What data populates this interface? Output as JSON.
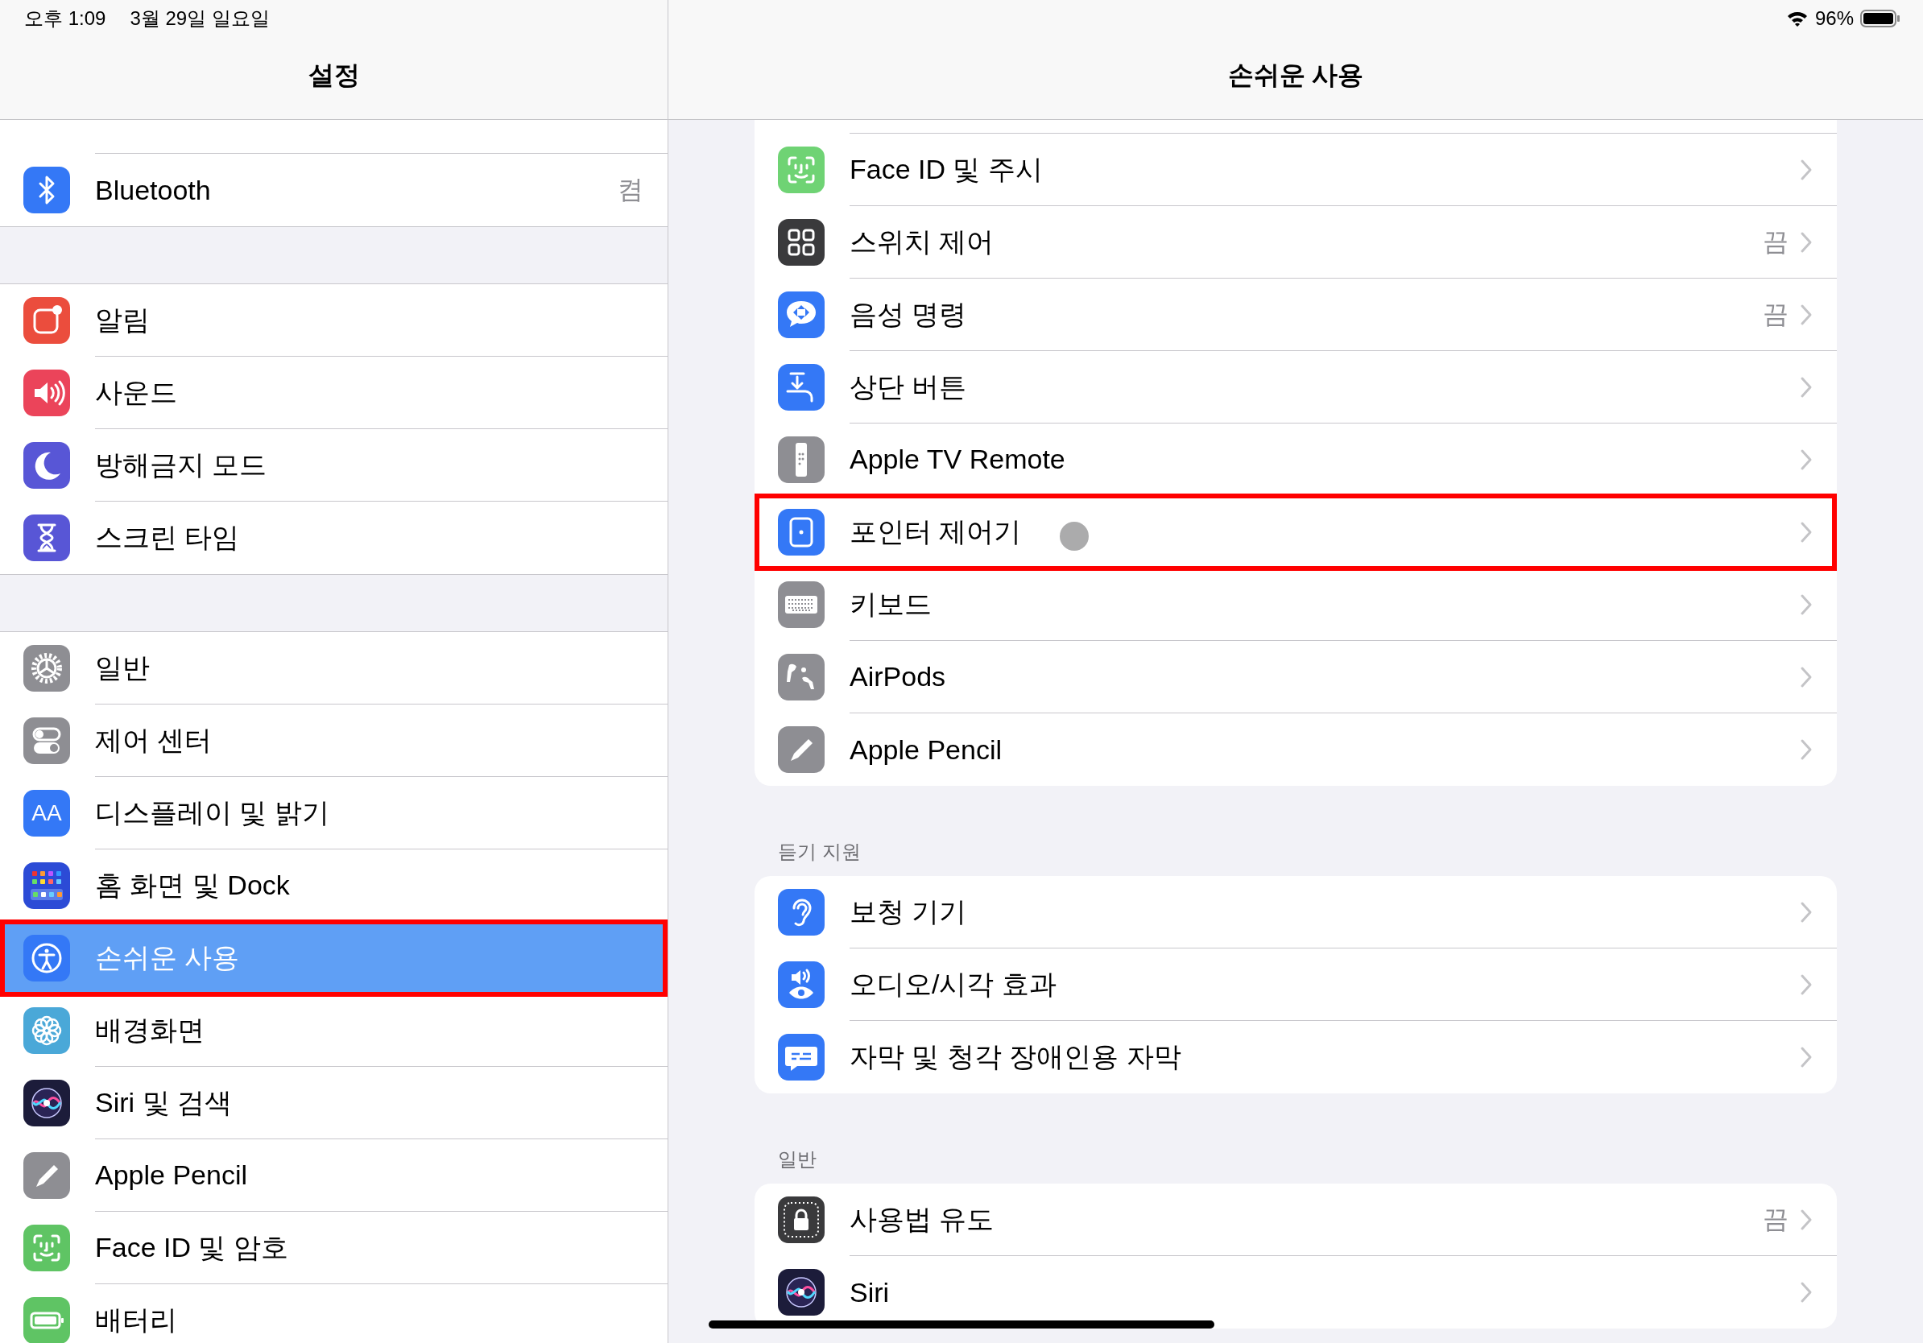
{
  "status_bar": {
    "time": "오후 1:09",
    "date": "3월 29일 일요일",
    "battery": "96%"
  },
  "sidebar": {
    "title": "설정",
    "sections": [
      [
        {
          "label": "Bluetooth",
          "value": "켬",
          "kind": "bluetooth",
          "color": "#3478f6",
          "selected": false,
          "annotated": false
        }
      ],
      [
        {
          "label": "알림",
          "kind": "notifications",
          "color": "#eb4d3d",
          "selected": false,
          "annotated": false
        },
        {
          "label": "사운드",
          "kind": "sound",
          "color": "#eb445a",
          "selected": false,
          "annotated": false
        },
        {
          "label": "방해금지 모드",
          "kind": "moon",
          "color": "#5856d6",
          "selected": false,
          "annotated": false
        },
        {
          "label": "스크린 타임",
          "kind": "hourglass",
          "color": "#5856d6",
          "selected": false,
          "annotated": false
        }
      ],
      [
        {
          "label": "일반",
          "kind": "gear",
          "color": "#8e8e93",
          "selected": false,
          "annotated": false
        },
        {
          "label": "제어 센터",
          "kind": "toggles",
          "color": "#8e8e93",
          "selected": false,
          "annotated": false
        },
        {
          "label": "디스플레이 및 밝기",
          "kind": "text",
          "icon_text": "AA",
          "color": "#3478f6",
          "selected": false,
          "annotated": false
        },
        {
          "label": "홈 화면 및 Dock",
          "kind": "grid",
          "color": "#2c4bd6",
          "selected": false,
          "annotated": false
        },
        {
          "label": "손쉬운 사용",
          "kind": "accessibility",
          "color": "#3478f6",
          "selected": true,
          "annotated": true
        },
        {
          "label": "배경화면",
          "kind": "flower",
          "color": "#4aa8d8",
          "selected": false,
          "annotated": false
        },
        {
          "label": "Siri 및 검색",
          "kind": "siri",
          "color": "#1c1c3a",
          "selected": false,
          "annotated": false
        },
        {
          "label": "Apple Pencil",
          "kind": "pencil",
          "color": "#8e8e93",
          "selected": false,
          "annotated": false
        },
        {
          "label": "Face ID 및 암호",
          "kind": "face",
          "color": "#5fc464",
          "selected": false,
          "annotated": false
        },
        {
          "label": "배터리",
          "kind": "battery",
          "color": "#5fc464",
          "selected": false,
          "annotated": false
        }
      ]
    ]
  },
  "detail": {
    "title": "손쉬운 사용",
    "groups": [
      {
        "items": [
          {
            "label": "Face ID 및 주시",
            "kind": "face",
            "color": "#6fd374",
            "annotated": false
          },
          {
            "label": "스위치 제어",
            "value": "끔",
            "kind": "switch",
            "color": "#3a3a3c",
            "annotated": false
          },
          {
            "label": "음성 명령",
            "value": "끔",
            "kind": "voice",
            "color": "#3478f6",
            "annotated": false
          },
          {
            "label": "상단 버튼",
            "kind": "topbutton",
            "color": "#3478f6",
            "annotated": false
          },
          {
            "label": "Apple TV Remote",
            "kind": "remote",
            "color": "#8e8e93",
            "annotated": false
          },
          {
            "label": "포인터 제어기",
            "kind": "pointer",
            "color": "#3478f6",
            "annotated": true
          },
          {
            "label": "키보드",
            "kind": "keyboard",
            "color": "#8e8e93",
            "annotated": false
          },
          {
            "label": "AirPods",
            "kind": "airpods",
            "color": "#8e8e93",
            "annotated": false
          },
          {
            "label": "Apple Pencil",
            "kind": "pencil",
            "color": "#8e8e93",
            "annotated": false
          }
        ]
      },
      {
        "header": "듣기 지원",
        "items": [
          {
            "label": "보청 기기",
            "kind": "ear",
            "color": "#3478f6",
            "annotated": false
          },
          {
            "label": "오디오/시각 효과",
            "kind": "audiovisual",
            "color": "#3478f6",
            "annotated": false
          },
          {
            "label": "자막 및 청각 장애인용 자막",
            "kind": "captions",
            "color": "#3478f6",
            "annotated": false
          }
        ]
      },
      {
        "header": "일반",
        "items": [
          {
            "label": "사용법 유도",
            "value": "끔",
            "kind": "lock",
            "color": "#3a3a3c",
            "annotated": false
          },
          {
            "label": "Siri",
            "kind": "siri",
            "color": "#1c1c3a",
            "annotated": false
          }
        ]
      }
    ]
  }
}
